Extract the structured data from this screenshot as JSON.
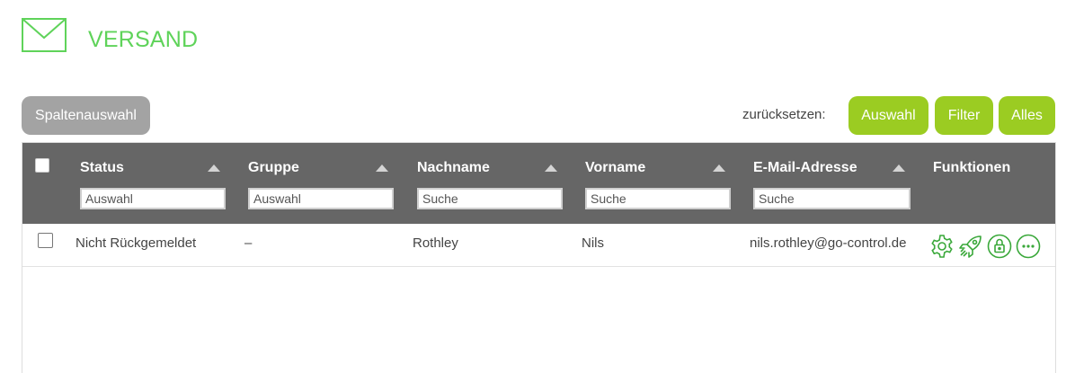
{
  "header": {
    "title": "VERSAND",
    "icon": "envelope-icon"
  },
  "toolbar": {
    "columns_button": "Spaltenauswahl",
    "reset_label": "zurücksetzen:",
    "reset_selection_button": "Auswahl",
    "reset_filter_button": "Filter",
    "reset_all_button": "Alles"
  },
  "table": {
    "columns": [
      {
        "label": "Status",
        "filter_placeholder": "Auswahl",
        "sortable": true
      },
      {
        "label": "Gruppe",
        "filter_placeholder": "Auswahl",
        "sortable": true
      },
      {
        "label": "Nachname",
        "filter_placeholder": "Suche",
        "sortable": true
      },
      {
        "label": "Vorname",
        "filter_placeholder": "Suche",
        "sortable": true
      },
      {
        "label": "E-Mail-Adresse",
        "filter_placeholder": "Suche",
        "sortable": true
      },
      {
        "label": "Funktionen",
        "sortable": false
      }
    ],
    "rows": [
      {
        "checked": false,
        "status": "Nicht Rückgemeldet",
        "group": "–",
        "last_name": "Rothley",
        "first_name": "Nils",
        "email": "nils.rothley@go-control.de",
        "functions": [
          "gear-icon",
          "rocket-icon",
          "lock-icon",
          "more-icon"
        ]
      }
    ]
  },
  "colors": {
    "accent_green": "#5fd35a",
    "button_green": "#9bcc22",
    "button_gray": "#a3a3a3",
    "header_bg": "#666666",
    "icon_green": "#3aa83a"
  }
}
